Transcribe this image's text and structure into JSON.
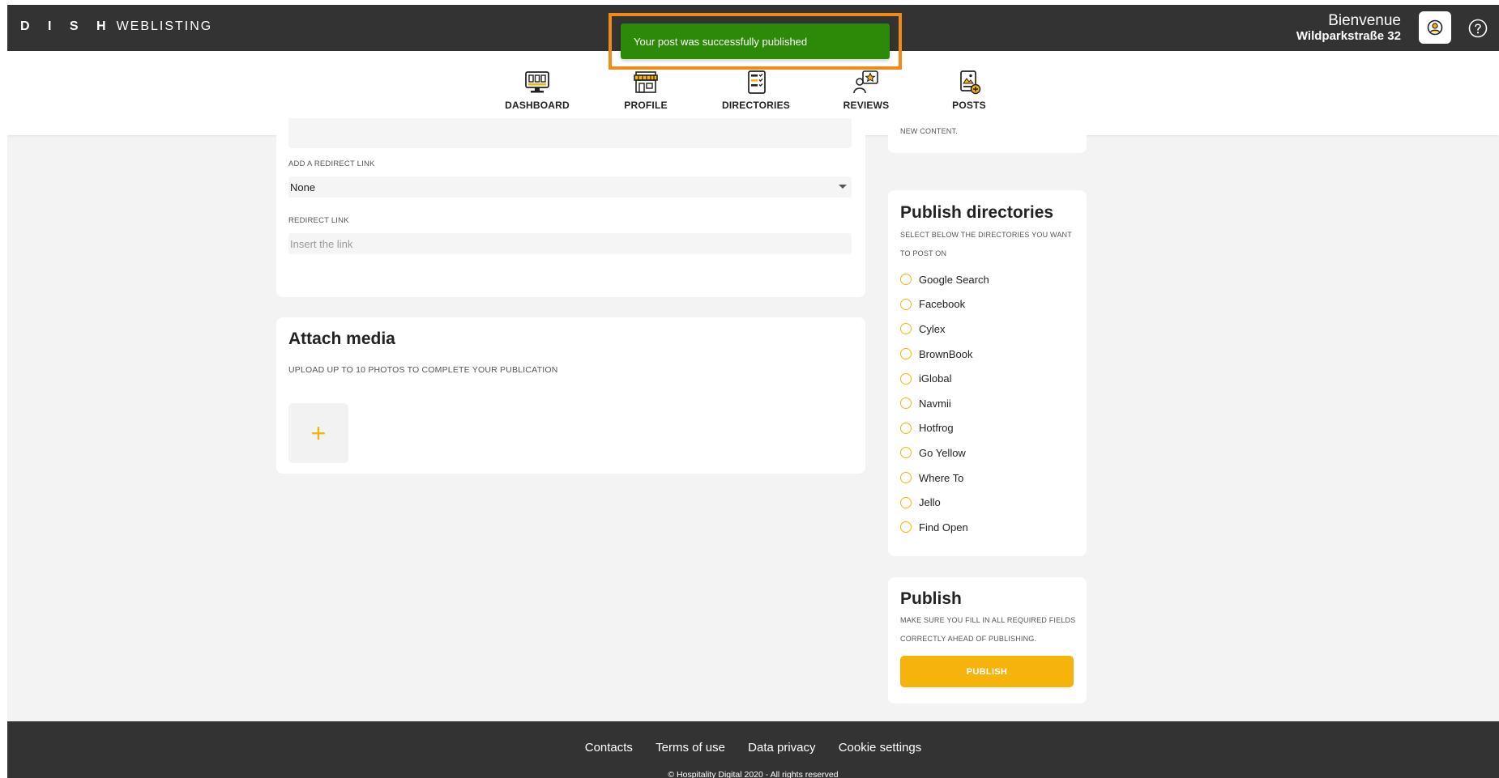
{
  "header": {
    "logo_bold": "D I S H",
    "logo_light": "WEBLISTING",
    "welcome": "Bienvenue",
    "location": "Wildparkstraße 32",
    "user_icon": "user-circle-icon",
    "help_icon": "question-circle-icon"
  },
  "toast": {
    "message": "Your post was successfully published"
  },
  "nav": {
    "items": [
      {
        "label": "DASHBOARD",
        "icon": "dashboard-icon"
      },
      {
        "label": "PROFILE",
        "icon": "storefront-icon"
      },
      {
        "label": "DIRECTORIES",
        "icon": "checklist-icon"
      },
      {
        "label": "REVIEWS",
        "icon": "star-review-icon"
      },
      {
        "label": "POSTS",
        "icon": "post-icon",
        "active": true
      }
    ]
  },
  "form": {
    "redirect_select_label": "ADD A REDIRECT LINK",
    "redirect_select_value": "None",
    "redirect_link_label": "REDIRECT LINK",
    "redirect_link_placeholder": "Insert the link"
  },
  "media": {
    "title": "Attach media",
    "subtitle": "UPLOAD UP TO 10 PHOTOS TO COMPLETE YOUR PUBLICATION",
    "add_symbol": "+"
  },
  "side_top": {
    "text": "NEW CONTENT."
  },
  "directories": {
    "title": "Publish directories",
    "subtitle_1": "SELECT BELOW THE DIRECTORIES YOU WANT",
    "subtitle_2": "TO POST ON",
    "items": [
      "Google Search",
      "Facebook",
      "Cylex",
      "BrownBook",
      "iGlobal",
      "Navmii",
      "Hotfrog",
      "Go Yellow",
      "Where To",
      "Jello",
      "Find Open"
    ]
  },
  "publish": {
    "title": "Publish",
    "note_1": "MAKE SURE YOU FILL IN ALL REQUIRED FIELDS",
    "note_2": "CORRECTLY AHEAD OF PUBLISHING.",
    "button": "PUBLISH"
  },
  "footer": {
    "links": [
      "Contacts",
      "Terms of use",
      "Data privacy",
      "Cookie settings"
    ],
    "copyright": "© Hospitality Digital 2020 - All rights reserved"
  },
  "colors": {
    "accent": "#f6b30b",
    "toast": "#2d8a08",
    "highlight": "#f28a13",
    "dark": "#333333"
  }
}
